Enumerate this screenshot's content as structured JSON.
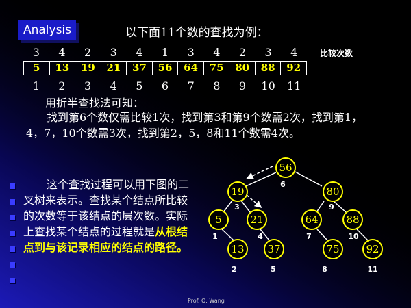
{
  "header": {
    "badge_label": "Analysis",
    "intro": "以下面11个数的查找为例："
  },
  "table": {
    "counts": [
      "3",
      "4",
      "2",
      "3",
      "4",
      "1",
      "3",
      "4",
      "2",
      "3",
      "4"
    ],
    "counts_label": "比较次数",
    "values": [
      "5",
      "13",
      "19",
      "21",
      "37",
      "56",
      "64",
      "75",
      "80",
      "88",
      "92"
    ],
    "indices": [
      "1",
      "2",
      "3",
      "4",
      "5",
      "6",
      "7",
      "8",
      "9",
      "10",
      "11"
    ]
  },
  "text": {
    "p1": "用折半查找法可知：",
    "p2": "找到第6个数仅需比较1次，找到第3和第9个数需2次，找到第1，4，7，10个数需3次，找到第2，5，8和11个数需4次。",
    "p3_normal": "这个查找过程可以用下图的二叉树来表示。查找某个结点所比较的次数等于该结点的层次数。实际上查找某个结点的过程就是",
    "p3_highlight": "从根结点到与该记录相应的结点的路径。"
  },
  "tree": {
    "nodes": [
      {
        "value": "56",
        "label": "6"
      },
      {
        "value": "19",
        "label": "3"
      },
      {
        "value": "80",
        "label": "9"
      },
      {
        "value": "5",
        "label": "1"
      },
      {
        "value": "21",
        "label": "4"
      },
      {
        "value": "64",
        "label": "7"
      },
      {
        "value": "88",
        "label": "10"
      },
      {
        "value": "13",
        "label": "2"
      },
      {
        "value": "37",
        "label": "5"
      },
      {
        "value": "75",
        "label": "8"
      },
      {
        "value": "92",
        "label": "11"
      }
    ]
  },
  "footer": "Prof. Q. Wang",
  "colors": {
    "background": "#000000",
    "accent_blue": "#1a1cc8",
    "highlight": "#ffff00",
    "text": "#ffffff"
  }
}
